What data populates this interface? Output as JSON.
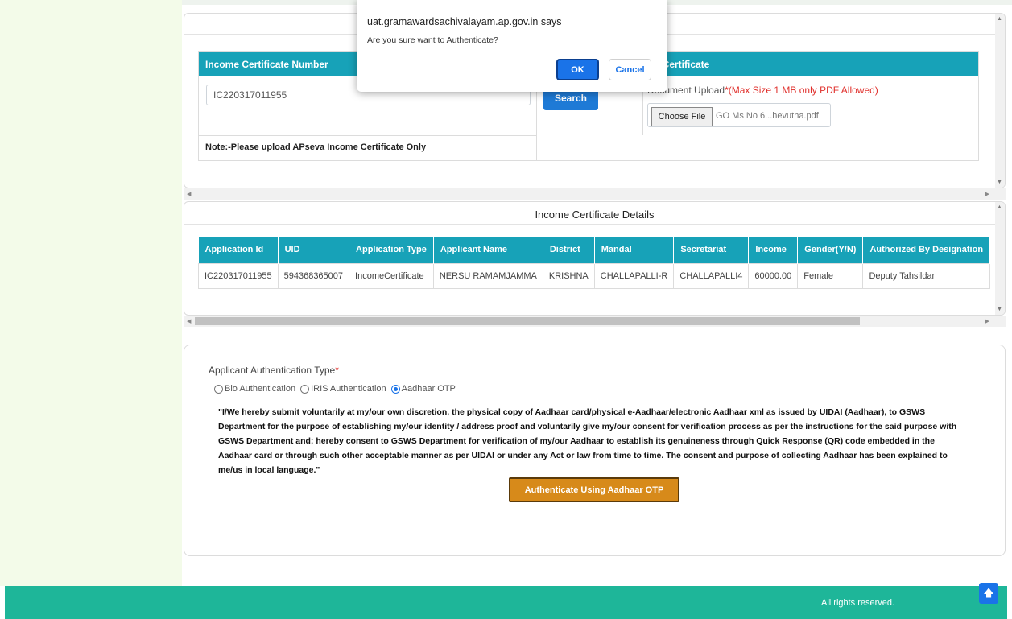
{
  "dialog": {
    "title": "uat.gramawardsachivalayam.ap.gov.in says",
    "message": "Are you sure want to Authenticate?",
    "ok": "OK",
    "cancel": "Cancel"
  },
  "certificate": {
    "number_header": "Income Certificate Number",
    "upload_header": "d Certificate",
    "number_value": "IC220317011955",
    "search_label": "Search",
    "upload_label": "Document Upload",
    "upload_hint": "*(Max Size 1 MB only PDF Allowed)",
    "choose_file": "Choose File",
    "file_name": "GO Ms No 6...hevutha.pdf",
    "note": "Note:-Please upload APseva Income Certificate Only"
  },
  "details": {
    "title": "Income Certificate Details",
    "columns": [
      "Application Id",
      "UID",
      "Application Type",
      "Applicant Name",
      "District",
      "Mandal",
      "Secretariat",
      "Income",
      "Gender(Y/N)",
      "Authorized By Designation"
    ],
    "row": [
      "IC220317011955",
      "594368365007",
      "IncomeCertificate",
      "NERSU RAMAMJAMMA",
      "KRISHNA",
      "CHALLAPALLI-R",
      "CHALLAPALLI4",
      "60000.00",
      "Female",
      "Deputy Tahsildar"
    ]
  },
  "auth": {
    "label": "Applicant Authentication Type",
    "required_mark": "*",
    "options": [
      "Bio Authentication",
      "IRIS Authentication",
      "Aadhaar OTP"
    ],
    "selected": "Aadhaar OTP",
    "consent": "\"I/We hereby submit voluntarily at my/our own discretion, the physical copy of Aadhaar card/physical e-Aadhaar/electronic Aadhaar xml as issued by UIDAI (Aadhaar), to GSWS Department for the purpose of establishing my/our identity / address proof and voluntarily give my/our consent for verification process as per the instructions for the said purpose with GSWS Department and; hereby consent to GSWS Department for verification of my/our Aadhaar to establish its genuineness through Quick Response (QR) code embedded in the Aadhaar card or through such other acceptable manner as per UIDAI or under any Act or law from time to time. The consent and purpose of collecting Aadhaar has been explained to me/us in local language.\"",
    "button": "Authenticate Using Aadhaar OTP"
  },
  "footer": {
    "text": "All rights reserved."
  },
  "icons": {
    "scroll_top": "arrow-up-icon"
  },
  "colors": {
    "table_header": "#17a2b8",
    "footer": "#1eb699",
    "auth_button": "#d78a1a",
    "primary": "#1a73e8"
  }
}
